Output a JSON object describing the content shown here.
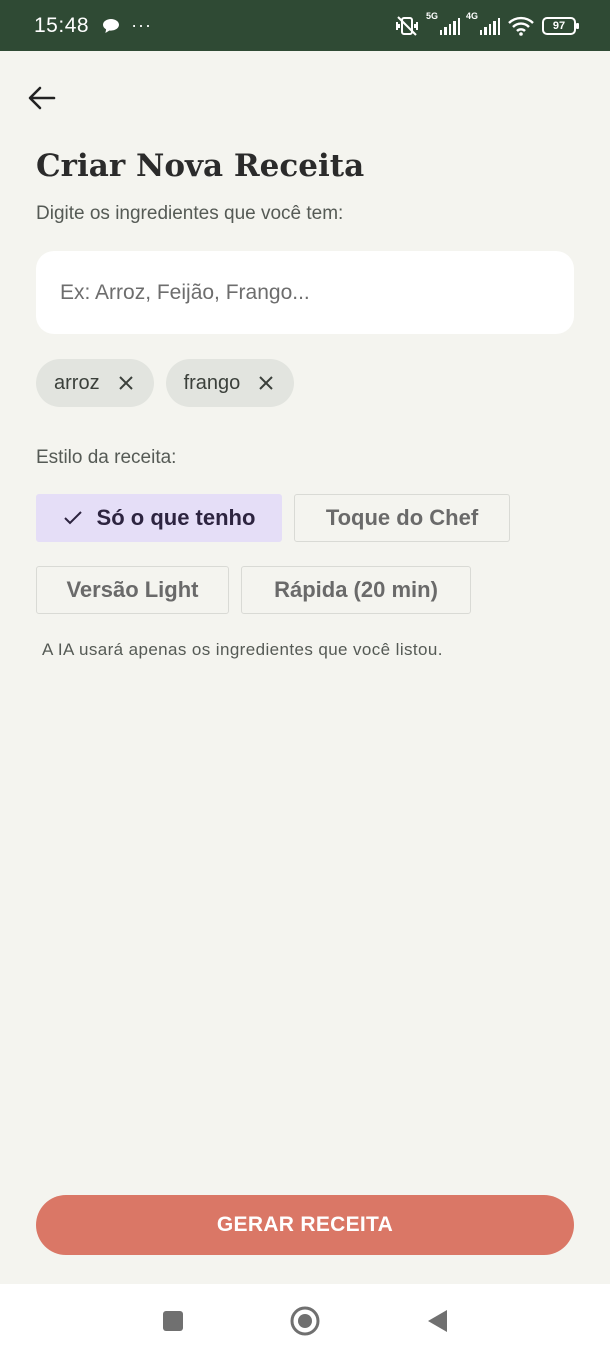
{
  "status_bar": {
    "time": "15:48",
    "more": "···",
    "network_5g": "5G",
    "network_4g": "4G",
    "battery": "97"
  },
  "header": {
    "title": "Criar Nova Receita",
    "subtitle": "Digite os ingredientes que você tem:"
  },
  "ingredient_input": {
    "placeholder": "Ex: Arroz, Feijão, Frango...",
    "value": ""
  },
  "ingredients": [
    {
      "label": "arroz"
    },
    {
      "label": "frango"
    }
  ],
  "style": {
    "label": "Estilo da receita:",
    "options": [
      {
        "label": "Só o que tenho",
        "selected": true
      },
      {
        "label": "Toque do Chef",
        "selected": false
      },
      {
        "label": "Versão Light",
        "selected": false
      },
      {
        "label": "Rápida (20 min)",
        "selected": false
      }
    ],
    "hint": "A IA usará apenas os ingredientes que você listou."
  },
  "actions": {
    "generate_label": "GERAR RECEITA"
  },
  "colors": {
    "status_bar": "#2f4a34",
    "background": "#f4f4ef",
    "primary_button": "#da7766",
    "selected_option": "#e5def7",
    "chip": "#e2e4df"
  }
}
